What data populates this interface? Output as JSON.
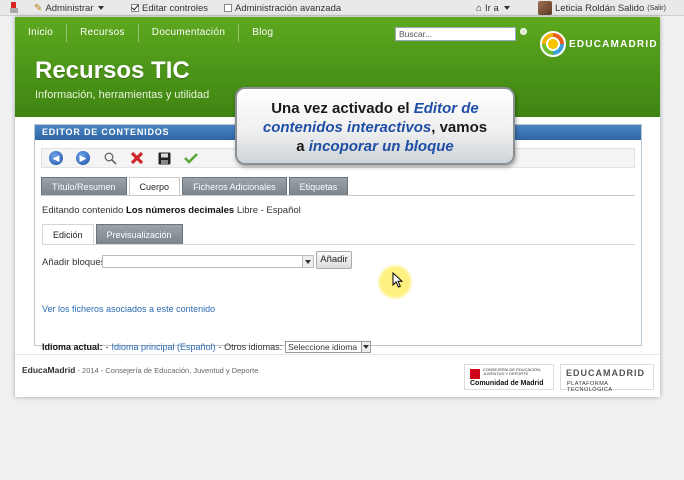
{
  "dockbar": {
    "admin_label": "Administrar",
    "edit_controls_label": "Editar controles",
    "advanced_admin_label": "Administración avanzada",
    "goto_label": "Ir a",
    "user_name": "Leticia Roldán Salido",
    "logout_label": "(Salir)"
  },
  "nav": {
    "items": [
      "Inicio",
      "Recursos",
      "Documentación",
      "Blog"
    ]
  },
  "search": {
    "placeholder": "Buscar..."
  },
  "brand": {
    "logo_text": "EDUCAMADRID"
  },
  "site": {
    "title": "Recursos TIC",
    "subtitle": "Información, herramientas y utilidad"
  },
  "tooltip": {
    "line1_prefix": "Una vez activado el ",
    "line1_em": "Editor de",
    "line2_em": "contenidos interactivos",
    "line2_suffix": ", vamos",
    "line3_prefix": "a ",
    "line3_em": "incoporar un bloque"
  },
  "portlet": {
    "title": "EDITOR DE CONTENIDOS",
    "toolbar_icons": [
      "back-icon",
      "forward-icon",
      "search-icon",
      "delete-icon",
      "save-icon",
      "check-icon"
    ],
    "tabs": [
      "Título/Resumen",
      "Cuerpo",
      "Ficheros Adicionales",
      "Etiquetas"
    ],
    "active_tab": "Cuerpo",
    "editing_prefix": "Editando contenido ",
    "editing_title": "Los números decimales",
    "editing_suffix": " Libre - Español",
    "subtabs": [
      "Edición",
      "Previsualización"
    ],
    "add_blocks_label": "Añadir bloques:",
    "add_button": "Añadir",
    "files_link": "Ver los ficheros asociados a este contenido",
    "language_label": "Idioma actual:",
    "language_dash": " - ",
    "language_link": "Idioma principal (Español)",
    "other_languages": " - Otros idiomas:",
    "language_select": "Seleccione idioma"
  },
  "footer": {
    "site": "EducaMadrid",
    "text": " - 2014 - Consejería de Educación, Juventud y Deporte",
    "cm_small": "CONSEJERÍA DE EDUCACIÓN, JUVENTUD Y DEPORTE",
    "cm_name": "Comunidad de Madrid",
    "em_top": "EDUCAMADRID",
    "em_bottom": "PLATAFORMA TECNOLÓGICA"
  }
}
